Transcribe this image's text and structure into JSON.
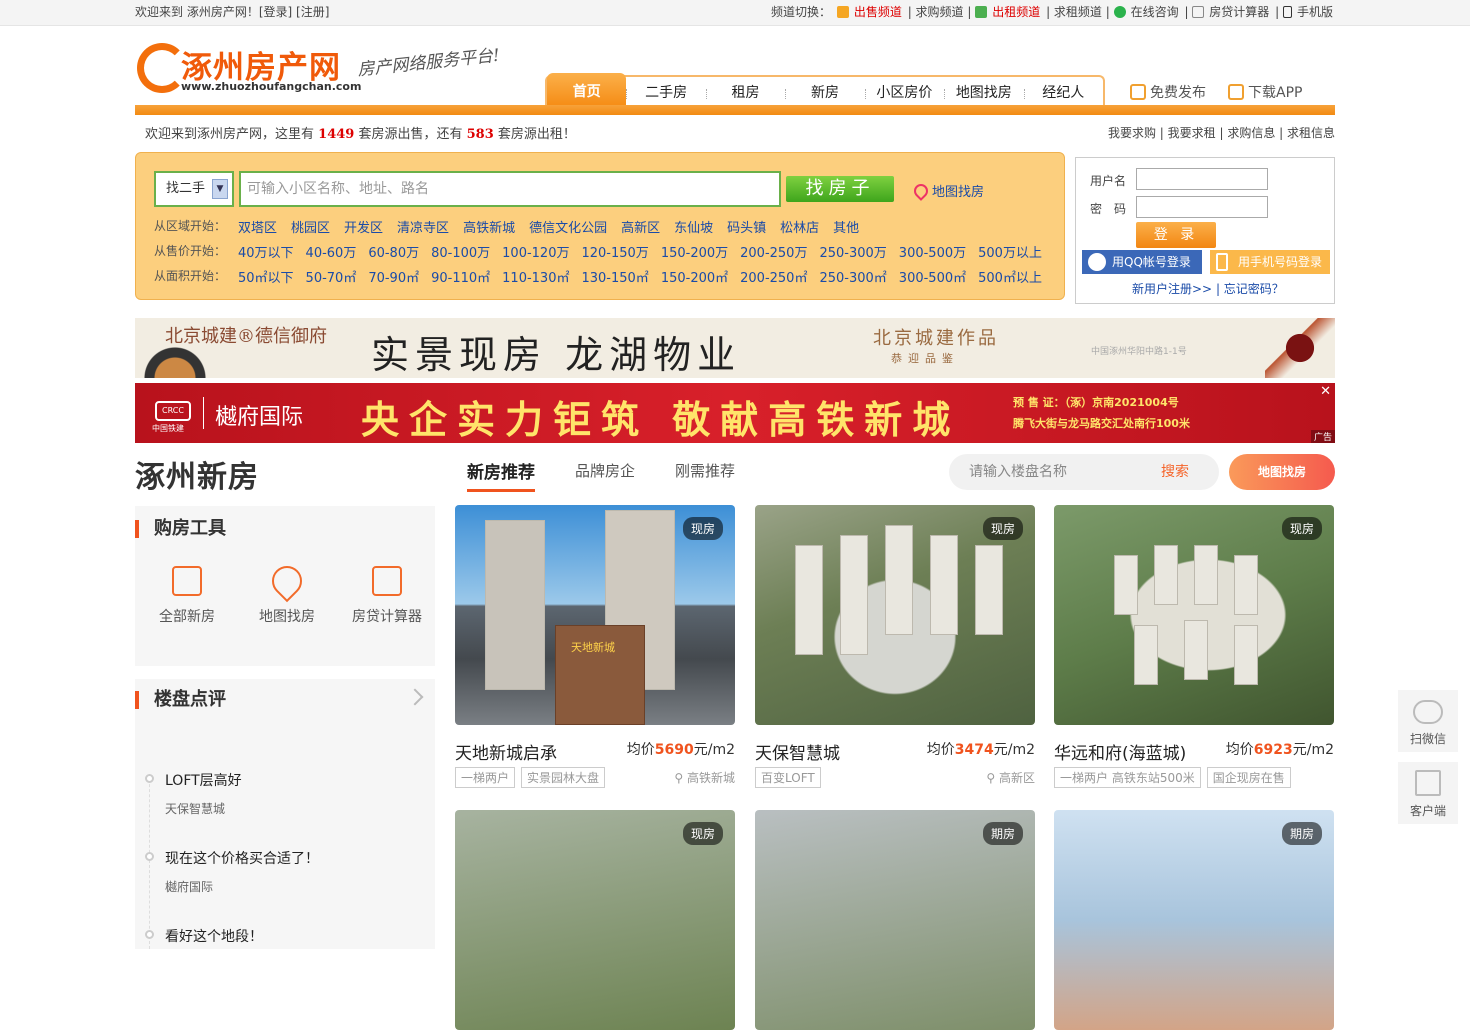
{
  "topbar": {
    "welcome": "欢迎来到 涿州房产网！",
    "login": "[登录]",
    "register": "[注册]",
    "channel_label": "频道切换：",
    "links": [
      "出售频道",
      "求购频道",
      "出租频道",
      "求租频道",
      "在线咨询",
      "房贷计算器",
      "手机版"
    ]
  },
  "header": {
    "logo_text": "涿州房产网",
    "logo_url": "www.zhuozhoufangchan.com",
    "slogan": "房产网络服务平台!",
    "nav": [
      "首页",
      "二手房",
      "租房",
      "新房",
      "小区房价",
      "地图找房",
      "经纪人"
    ],
    "free_publish": "免费发布",
    "download_app": "下载APP"
  },
  "welcome_bar": {
    "prefix": "欢迎来到涿州房产网，这里有",
    "sale_count": "1449",
    "mid": "套房源出售，还有",
    "rent_count": "583",
    "suffix": "套房源出租！",
    "right_links": "我要求购 | 我要求租 | 求购信息 | 求租信息"
  },
  "search": {
    "select_value": "找二手",
    "placeholder": "可输入小区名称、地址、路名",
    "button": "找房子",
    "map_link": "地图找房",
    "area_label": "从区域开始：",
    "areas": [
      "双塔区",
      "桃园区",
      "开发区",
      "清凉寺区",
      "高铁新城",
      "德信文化公园",
      "高新区",
      "东仙坡",
      "码头镇",
      "松林店",
      "其他"
    ],
    "price_label": "从售价开始：",
    "prices": [
      "40万以下",
      "40-60万",
      "60-80万",
      "80-100万",
      "100-120万",
      "120-150万",
      "150-200万",
      "200-250万",
      "250-300万",
      "300-500万",
      "500万以上"
    ],
    "size_label": "从面积开始：",
    "sizes": [
      "50㎡以下",
      "50-70㎡",
      "70-90㎡",
      "90-110㎡",
      "110-130㎡",
      "130-150㎡",
      "150-200㎡",
      "200-250㎡",
      "250-300㎡",
      "300-500㎡",
      "500㎡以上"
    ]
  },
  "login": {
    "user_label": "用户名",
    "pass_label": "密　码",
    "button": "登 录",
    "qq": "用QQ帐号登录",
    "phone": "用手机号码登录",
    "register": "新用户注册>>",
    "forgot": "忘记密码？"
  },
  "ad1": {
    "brand": "北京城建®德信御府",
    "main": "实景现房  龙湖物业",
    "right": "北京城建作品",
    "right_sub": "恭迎品鉴",
    "small": "中国涿州华阳中路1-1号"
  },
  "ad2": {
    "logo": "CRCC",
    "logo_sub": "中国铁建",
    "brand": "樾府国际",
    "main": "央企实力钜筑 敬献高铁新城",
    "license": "预 售 证：（涿）京南2021004号",
    "address": "腾飞大街与龙马路交汇处南行100米",
    "close": "✕",
    "ad_tag": "广告"
  },
  "newhouse": {
    "title": "涿州新房",
    "tabs": [
      "新房推荐",
      "品牌房企",
      "刚需推荐"
    ],
    "search_placeholder": "请输入楼盘名称",
    "search_button": "搜索",
    "map_button": "地图找房"
  },
  "tools": {
    "title": "购房工具",
    "items": [
      "全部新房",
      "地图找房",
      "房贷计算器"
    ]
  },
  "reviews": {
    "title": "楼盘点评",
    "items": [
      {
        "text": "LOFT层高好",
        "project": "天保智慧城"
      },
      {
        "text": "现在这个价格买合适了！",
        "project": "樾府国际"
      },
      {
        "text": "看好这个地段！",
        "project": ""
      }
    ]
  },
  "listings": [
    {
      "name": "天地新城启承",
      "status": "现房",
      "price_prefix": "均价",
      "price": "5690",
      "unit": "元/m2",
      "tags": [
        "一梯两户",
        "实景园林大盘"
      ],
      "location": "高铁新城",
      "img_caption": "天地新城"
    },
    {
      "name": "天保智慧城",
      "status": "现房",
      "price_prefix": "均价",
      "price": "3474",
      "unit": "元/m2",
      "tags": [
        "百变LOFT"
      ],
      "location": "高新区"
    },
    {
      "name": "华远和府(海蓝城)",
      "status": "现房",
      "price_prefix": "均价",
      "price": "6923",
      "unit": "元/m2",
      "tags": [
        "一梯两户 高铁东站500米",
        "国企现房在售"
      ],
      "location": ""
    },
    {
      "name": "",
      "status": "现房"
    },
    {
      "name": "",
      "status": "期房"
    },
    {
      "name": "",
      "status": "期房"
    }
  ],
  "side": {
    "wechat": "扫微信",
    "client": "客户端"
  },
  "colors": {
    "accent": "#f28a12",
    "price": "#f0531e",
    "link": "#1a4ba8"
  }
}
